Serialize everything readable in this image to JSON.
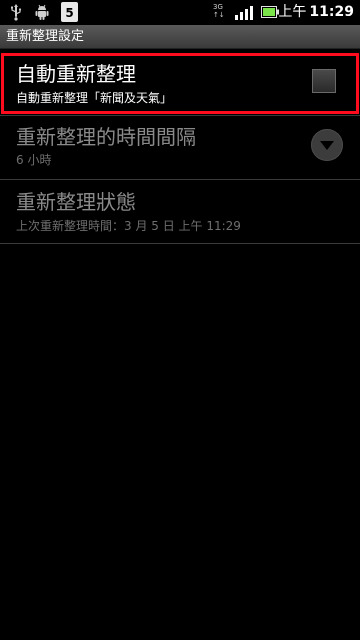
{
  "status_bar": {
    "icons": [
      "usb-icon",
      "android-debug-icon",
      "calendar-icon",
      "network-3g-icon",
      "signal-icon",
      "battery-icon"
    ],
    "calendar_day": "5",
    "network_type": "3G",
    "am_pm": "上午",
    "time": "11:29"
  },
  "titlebar": {
    "title": "重新整理設定"
  },
  "preferences": {
    "auto_refresh": {
      "title": "自動重新整理",
      "summary": "自動重新整理「新聞及天氣」",
      "checked": false
    },
    "refresh_interval": {
      "title": "重新整理的時間間隔",
      "summary": "6 小時"
    },
    "refresh_status": {
      "title": "重新整理狀態",
      "summary": "上次重新整理時間：3 月 5 日 上午 11:29"
    }
  },
  "colors": {
    "highlight_border": "#ff0d1f",
    "background": "#000000",
    "disabled_text": "#8a8a8a",
    "battery_fill": "#7be34a"
  }
}
